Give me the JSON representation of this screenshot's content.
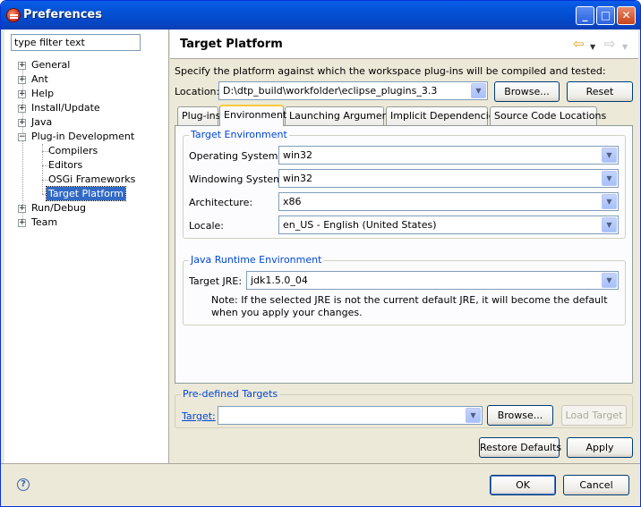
{
  "window": {
    "title": "Preferences"
  },
  "titlebar": {
    "minimize": "_",
    "maximize": "□",
    "close": "✕"
  },
  "filter": {
    "value": "type filter text"
  },
  "tree": {
    "general": "General",
    "ant": "Ant",
    "help": "Help",
    "install_update": "Install/Update",
    "java": "Java",
    "plugin_dev": "Plug-in Development",
    "compilers": "Compilers",
    "editors": "Editors",
    "osgi": "OSGi Frameworks",
    "target_platform": "Target Platform",
    "run_debug": "Run/Debug",
    "team": "Team"
  },
  "page": {
    "title": "Target Platform",
    "back_icon": "⇦",
    "forward_icon": "⇨",
    "description": "Specify the platform against which the workspace plug-ins will be compiled and tested:",
    "location_label": "Location:",
    "location_value": "D:\\dtp_build\\workfolder\\eclipse_plugins_3.3",
    "browse_label": "Browse...",
    "reset_label": "Reset"
  },
  "tabs": [
    "Plug-ins",
    "Environment",
    "Launching Arguments",
    "Implicit Dependencies",
    "Source Code Locations"
  ],
  "environment": {
    "group_title": "Target Environment",
    "os_label": "Operating System:",
    "os_value": "win32",
    "ws_label": "Windowing System:",
    "ws_value": "win32",
    "arch_label": "Architecture:",
    "arch_value": "x86",
    "locale_label": "Locale:",
    "locale_value": "en_US - English (United States)"
  },
  "jre": {
    "group_title": "Java Runtime Environment",
    "label": "Target JRE:",
    "value": "jdk1.5.0_04",
    "note_line1": "Note: If the selected JRE is not the current default JRE, it will become the default",
    "note_line2": "when you apply your changes."
  },
  "predefined": {
    "group_title": "Pre-defined Targets",
    "target_label": "Target:",
    "target_value": "",
    "browse_label": "Browse...",
    "load_label": "Load Target"
  },
  "actions": {
    "restore_defaults": "Restore Defaults",
    "apply": "Apply",
    "ok": "OK",
    "cancel": "Cancel"
  },
  "colors": {
    "title_bar": "#0454d8",
    "selection": "#316ac5",
    "group_title": "#0046d5",
    "tab_highlight": "#ffc83c"
  }
}
